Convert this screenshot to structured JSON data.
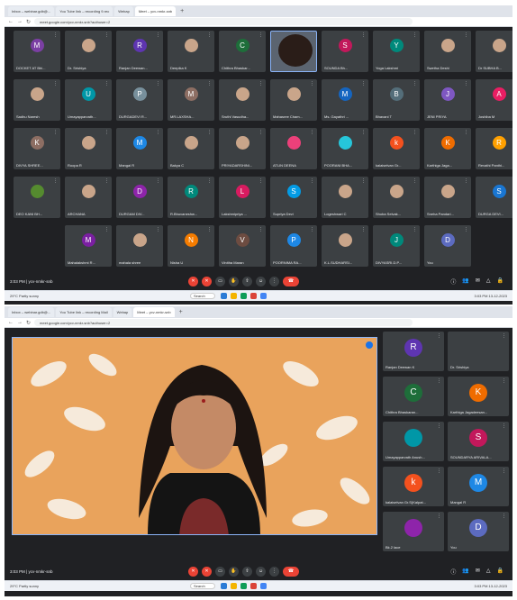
{
  "screenshot1": {
    "tabs": [
      "Inbox – webinar.gdb@...",
      "You Tube link – recording 9.rec",
      "Webap",
      "Meet – ycv-nmkr-snb"
    ],
    "url": "meet.google.com/ycv-nmkr-snb?authuser=2",
    "tiles": [
      {
        "name": "DOCKET AT Bhi...",
        "initial": "M",
        "color": "#7b3fa3"
      },
      {
        "name": "Dr. Srishiya",
        "initial": "",
        "color": ""
      },
      {
        "name": "Ranjan Deewan...",
        "initial": "R",
        "color": "#5e35b1"
      },
      {
        "name": "Deepika K",
        "initial": "",
        "color": ""
      },
      {
        "name": "Chithra Bhaskar...",
        "initial": "C",
        "color": "#1e6e3a"
      },
      {
        "name": "",
        "initial": "",
        "color": "",
        "active": true
      },
      {
        "name": "SOUNDA Bh...",
        "initial": "S",
        "color": "#c2185b"
      },
      {
        "name": "Yoga Lakshmi",
        "initial": "Y",
        "color": "#00897b"
      },
      {
        "name": "Swetha Deshi",
        "initial": "",
        "color": ""
      },
      {
        "name": "Dr SUBHA B...",
        "initial": "",
        "color": ""
      },
      {
        "name": "Sadhu Naresh",
        "initial": "",
        "color": ""
      },
      {
        "name": "Umayapparvath...",
        "initial": "U",
        "color": "#0097a7"
      },
      {
        "name": "DURGADEVI R...",
        "initial": "P",
        "color": "#78909c"
      },
      {
        "name": "MR.LAXSHA...",
        "initial": "M",
        "color": "#8d6e63"
      },
      {
        "name": "Sruthi Vasudha...",
        "initial": "",
        "color": ""
      },
      {
        "name": "Mahasree Cham...",
        "initial": "",
        "color": ""
      },
      {
        "name": "Ms. Gayathri ...",
        "initial": "M",
        "color": "#1565c0"
      },
      {
        "name": "Bhavani T",
        "initial": "B",
        "color": "#546e7a"
      },
      {
        "name": "JENI PRIYA",
        "initial": "J",
        "color": "#7e57c2"
      },
      {
        "name": "Joshiba M",
        "initial": "A",
        "color": "#e91e63"
      },
      {
        "name": "DIVYA SHREE...",
        "initial": "K",
        "color": "#8d6e63"
      },
      {
        "name": "Roopa R",
        "initial": "",
        "color": ""
      },
      {
        "name": "Mangal R",
        "initial": "M",
        "color": "#1e88e5"
      },
      {
        "name": "Bakya C",
        "initial": "",
        "color": ""
      },
      {
        "name": "PRIYADARSHINI...",
        "initial": "",
        "color": ""
      },
      {
        "name": "ATLIN DEENA",
        "initial": "",
        "color": "#ec407a"
      },
      {
        "name": "POORANI BHA...",
        "initial": "",
        "color": "#26c6da"
      },
      {
        "name": "kalaiselvan Gr...",
        "initial": "k",
        "color": "#f4511e"
      },
      {
        "name": "Karthiga Jaga...",
        "initial": "K",
        "color": "#ef6c00"
      },
      {
        "name": "Revathi Panthi...",
        "initial": "R",
        "color": "#ffa000"
      },
      {
        "name": "DEO KANI BH...",
        "initial": "",
        "color": "#558b2f"
      },
      {
        "name": "ARCHANA",
        "initial": "",
        "color": ""
      },
      {
        "name": "DURGAM DIV...",
        "initial": "D",
        "color": "#8e24aa"
      },
      {
        "name": "R.Bhuvaneshw...",
        "initial": "R",
        "color": "#00897b"
      },
      {
        "name": "Lakshmipriya ...",
        "initial": "L",
        "color": "#d81b60"
      },
      {
        "name": "Supriya Devi",
        "initial": "S",
        "color": "#039be5"
      },
      {
        "name": "Logeshwari C",
        "initial": "",
        "color": ""
      },
      {
        "name": "Shoba Selvak...",
        "initial": "",
        "color": ""
      },
      {
        "name": "Sneha Pandari...",
        "initial": "",
        "color": ""
      },
      {
        "name": "DURGA DEVI...",
        "initial": "S",
        "color": "#1976d2"
      },
      {
        "name": "Mahalakshmi R...",
        "initial": "M",
        "color": "#7b1fa2"
      },
      {
        "name": "mahala shree",
        "initial": "",
        "color": ""
      },
      {
        "name": "Nisha U",
        "initial": "N",
        "color": "#f57c00"
      },
      {
        "name": "Vinitha Maran",
        "initial": "V",
        "color": "#6d4c41"
      },
      {
        "name": "POORNIMA RA...",
        "initial": "P",
        "color": "#1e88e5"
      },
      {
        "name": "K.L.SUDHARSI...",
        "initial": "",
        "color": ""
      },
      {
        "name": "DIVYASRI.D.P...",
        "initial": "J",
        "color": "#00897b"
      },
      {
        "name": "You",
        "initial": "D",
        "color": "#5c6bc0"
      }
    ],
    "meeting_time": "3:03 PM",
    "meeting_code": "ycv-nmkr-snb",
    "taskbar_search": "Search",
    "taskbar_weather": "29°C Partly sunny",
    "taskbar_clock": "3:03 PM 13-12-2023"
  },
  "screenshot2": {
    "tabs": [
      "Inbox – webinar.gdb@...",
      "You Tube link – recording Mail",
      "Webap",
      "Meet – ycv-nmkr-snb"
    ],
    "url": "meet.google.com/ycv-nmkr-snb?authuser=2",
    "side_tiles": [
      {
        "name": "Ranjan Deewan K",
        "initial": "R",
        "color": "#5e35b1"
      },
      {
        "name": "Dr. Srishiya",
        "initial": "",
        "color": ""
      },
      {
        "name": "Chithra Bhaskaran...",
        "initial": "C",
        "color": "#1e6e3a"
      },
      {
        "name": "Karthiga Jagadeesan...",
        "initial": "K",
        "color": "#ef6c00"
      },
      {
        "name": "Umayapparvath Anush...",
        "initial": "",
        "color": "#0097a7"
      },
      {
        "name": "SOUNDARYA ARIVALA...",
        "initial": "S",
        "color": "#c2185b"
      },
      {
        "name": "kalaiselvan Gr.S(Kalpat...",
        "initial": "k",
        "color": "#f4511e"
      },
      {
        "name": "Mangal R",
        "initial": "M",
        "color": "#1e88e5"
      },
      {
        "name": "Bk.2 lace",
        "initial": "",
        "color": "#8e24aa"
      },
      {
        "name": "You",
        "initial": "D",
        "color": "#5c6bc0"
      }
    ],
    "meeting_time": "3:03 PM",
    "meeting_code": "ycv-nmkr-snb",
    "taskbar_search": "Search",
    "taskbar_weather": "29°C Partly sunny",
    "taskbar_clock": "3:03 PM 13-12-2023"
  },
  "colors": {
    "meet_bg": "#202124",
    "tile_bg": "#3c4043",
    "end_call": "#ea4335",
    "accent": "#8ab4f8"
  }
}
